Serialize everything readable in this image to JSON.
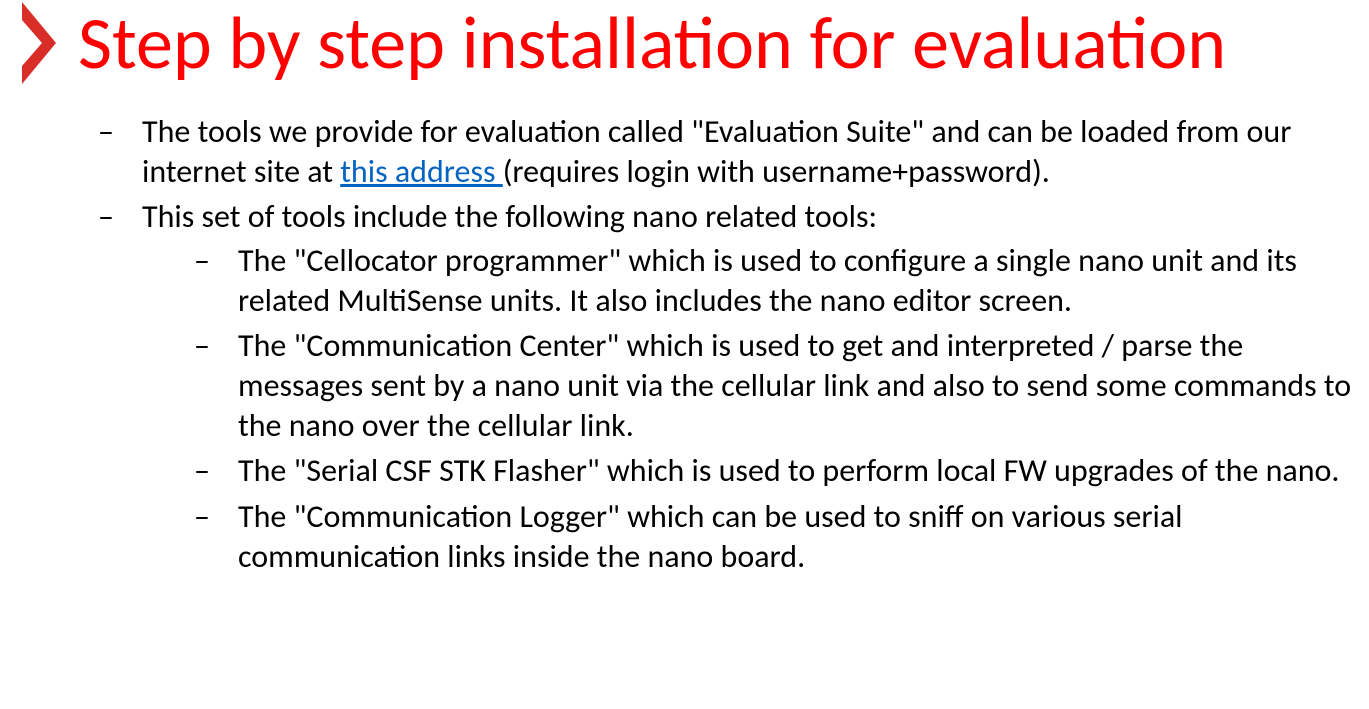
{
  "title": "Step by step installation for evaluation",
  "bullets": {
    "b1_pre": "The tools we provide for evaluation called \"Evaluation Suite\" and can be loaded from our internet site at ",
    "b1_link": "this address ",
    "b1_post": "(requires login with username+password).",
    "b2": "This set of tools include the following nano related tools:",
    "sub1": "The \"Cellocator programmer\" which is used to configure a single nano unit and its related MultiSense units. It also includes the nano editor screen.",
    "sub2": "The \"Communication Center\" which is used to get and interpreted / parse the messages sent by a nano unit via the cellular link and also to send some commands to the nano over the cellular link.",
    "sub3": "The \"Serial CSF STK Flasher\" which is used to perform local FW upgrades of the nano.",
    "sub4": "The \"Communication Logger\" which can be used to sniff on various serial communication links inside the nano board."
  }
}
